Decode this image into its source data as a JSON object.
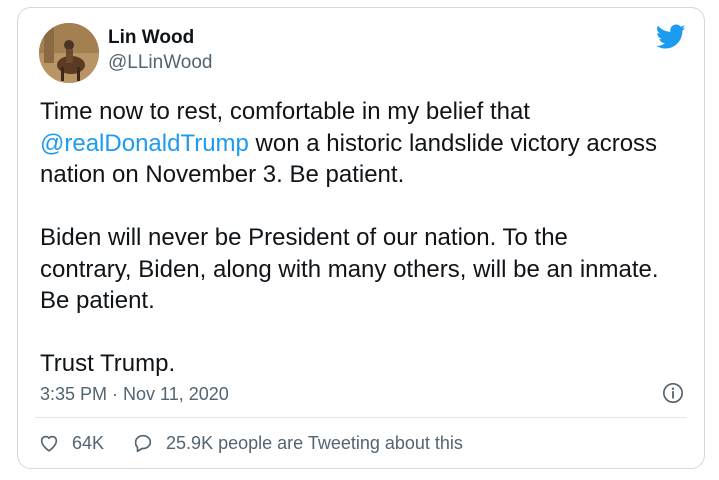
{
  "tweet": {
    "author_name": "Lin Wood",
    "author_handle": "@LLinWood",
    "text_before_mention": "Time now to rest, comfortable in my belief that\n",
    "mention": "@realDonaldTrump",
    "text_after_mention": " won a historic landslide victory across\nnation on November 3. Be patient.\n\nBiden will never be President of our nation. To the\ncontrary, Biden, along with many others, will be an inmate.\nBe patient.\n\nTrust Trump.",
    "timestamp": "3:35 PM · Nov 11, 2020",
    "likes": "64K",
    "conversation": "25.9K people are Tweeting about this"
  },
  "icons": {
    "logo": "twitter-bird-icon",
    "info": "info-icon",
    "like": "heart-icon",
    "reply": "speech-bubble-icon"
  },
  "colors": {
    "accent": "#1d9bf0",
    "secondary_text": "#536471",
    "border": "#cfd9de"
  }
}
